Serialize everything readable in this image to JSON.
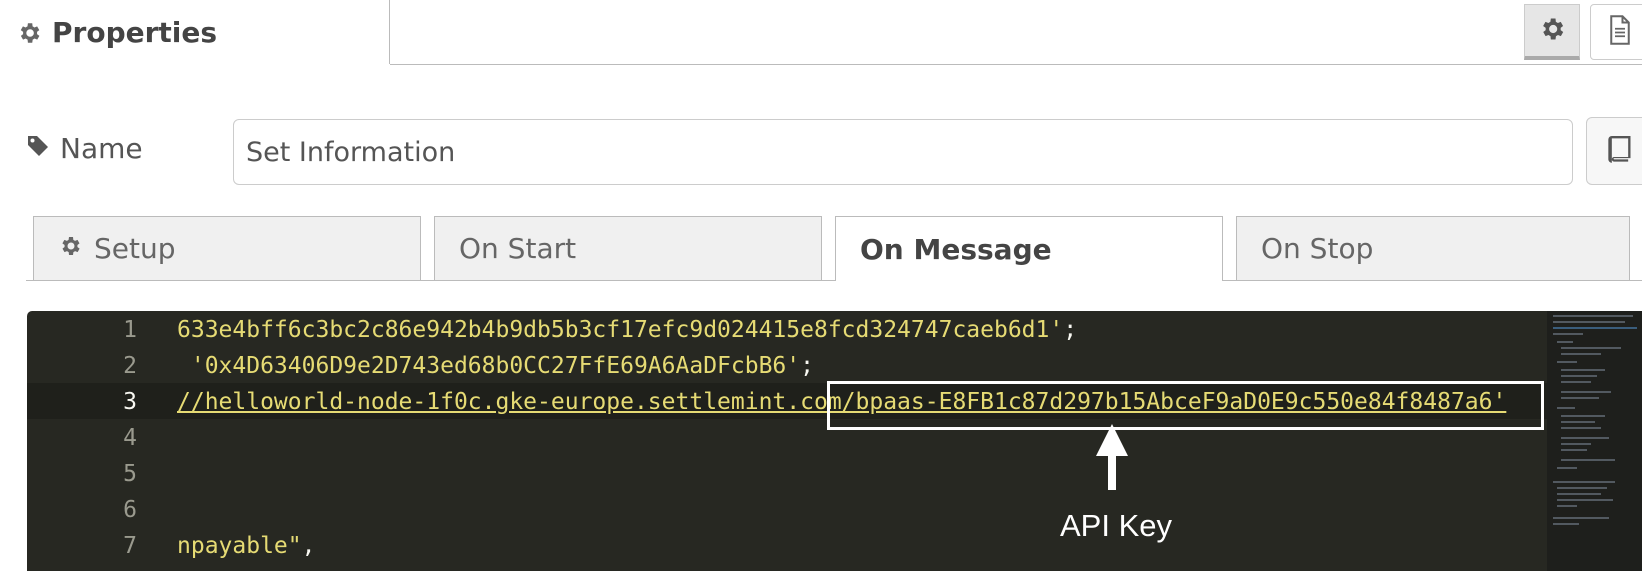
{
  "header": {
    "title": "Properties",
    "icons": [
      "gear-icon",
      "settings-gear-icon",
      "info-document-icon"
    ]
  },
  "name_row": {
    "label": "Name",
    "icon": "tag-icon",
    "value": "Set Information",
    "side_button_icon": "book-icon"
  },
  "tabs": [
    {
      "label": "Setup",
      "icon": "gear-icon",
      "active": false
    },
    {
      "label": "On Start",
      "active": false
    },
    {
      "label": "On Message",
      "active": true
    },
    {
      "label": "On Stop",
      "active": false
    }
  ],
  "editor": {
    "lines": [
      {
        "n": "1",
        "text": "633e4bff6c3bc2c86e942b4b9db5b3cf17efc9d024415e8fcd324747caeb6d1'",
        "end": ";"
      },
      {
        "n": "2",
        "text": " '0x4D63406D9e2D743ed68b0CC27FfE69A6AaDFcbB6'",
        "end": ";"
      },
      {
        "n": "3",
        "text": "//helloworld-node-1f0c.gke-europe.settlemint.com/bpaas-E8FB1c87d297b15AbceF9aD0E9c550e84f8487a6'",
        "end": ""
      },
      {
        "n": "4",
        "text": "",
        "end": ""
      },
      {
        "n": "5",
        "text": "",
        "end": ""
      },
      {
        "n": "6",
        "text": "",
        "end": ""
      },
      {
        "n": "7",
        "text": "npayable\"",
        "end": ","
      }
    ],
    "colors": {
      "background": "#272822",
      "string": "#e6db74",
      "punctuation": "#f8f8f2"
    }
  },
  "annotation": {
    "label": "API Key"
  }
}
